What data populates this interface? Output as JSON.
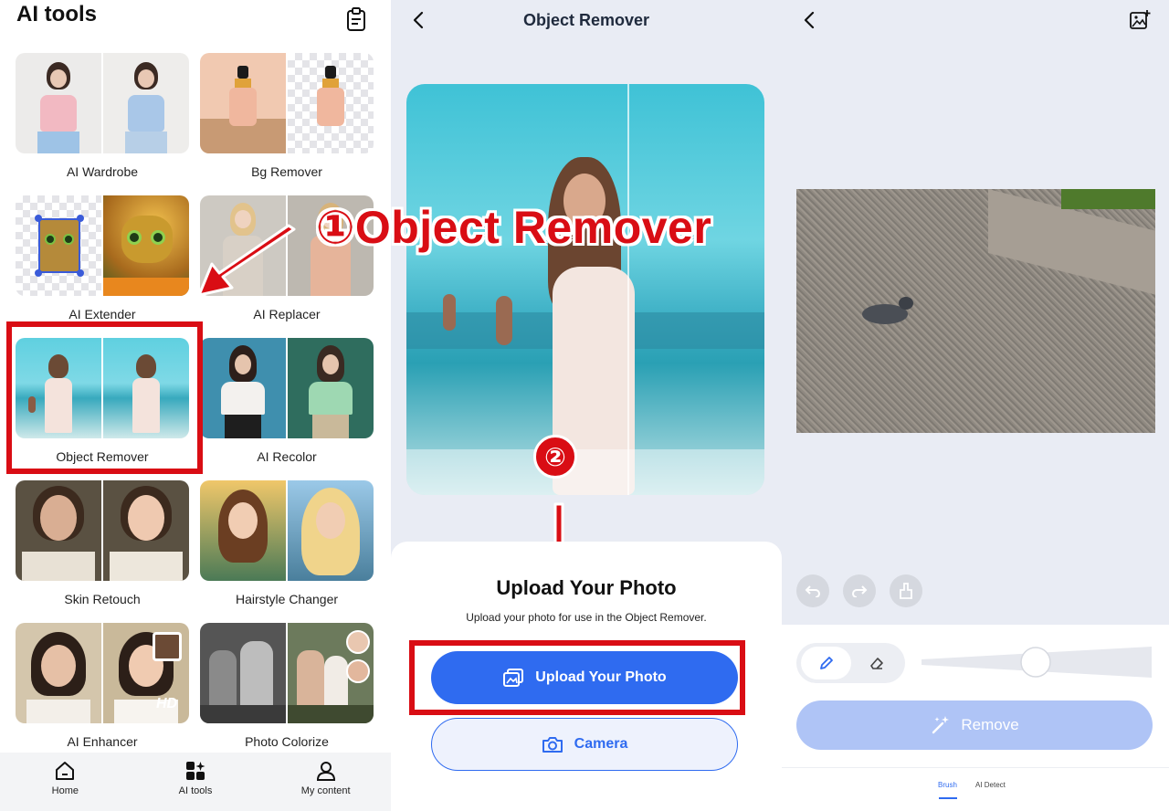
{
  "left": {
    "title": "AI tools",
    "tools": [
      {
        "label": "AI Wardrobe"
      },
      {
        "label": "Bg Remover"
      },
      {
        "label": "AI Extender"
      },
      {
        "label": "AI Replacer"
      },
      {
        "label": "Object Remover",
        "highlighted": true
      },
      {
        "label": "AI Recolor"
      },
      {
        "label": "Skin Retouch"
      },
      {
        "label": "Hairstyle Changer"
      },
      {
        "label": "AI Enhancer",
        "badge": "HD"
      },
      {
        "label": "Photo Colorize"
      }
    ],
    "nav": [
      {
        "label": "Home",
        "icon": "home-icon"
      },
      {
        "label": "AI tools",
        "icon": "grid-sparkle-icon",
        "active": true
      },
      {
        "label": "My content",
        "icon": "user-icon"
      }
    ]
  },
  "middle": {
    "title": "Object Remover",
    "sheet_title": "Upload Your Photo",
    "sheet_subtitle": "Upload your photo for use in the Object Remover.",
    "upload_label": "Upload Your Photo",
    "camera_label": "Camera"
  },
  "right": {
    "remove_label": "Remove",
    "tabs": [
      {
        "label": "Brush",
        "active": true
      },
      {
        "label": "AI Detect"
      }
    ]
  },
  "annotations": {
    "callout_text": "①Object Remover",
    "step_marker": "②"
  },
  "colors": {
    "accent_blue": "#2f6bf0",
    "highlight_red": "#d90d14",
    "disabled_blue": "#afc4f6"
  }
}
